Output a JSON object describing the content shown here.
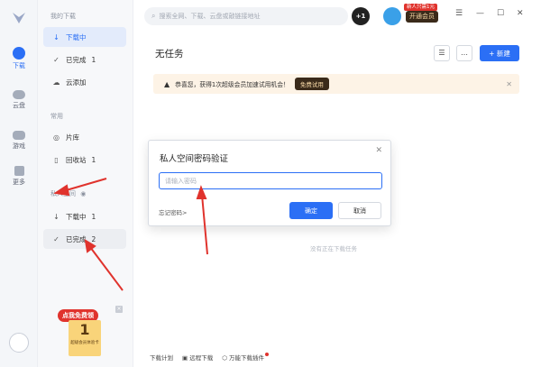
{
  "rail": {
    "items": [
      {
        "label": "下载",
        "icon": "download-icon",
        "active": true
      },
      {
        "label": "云盘",
        "icon": "cloud-icon"
      },
      {
        "label": "游戏",
        "icon": "gamepad-icon"
      },
      {
        "label": "更多",
        "icon": "apps-icon"
      }
    ]
  },
  "sidebar": {
    "section_my_downloads": "我的下载",
    "downloading": {
      "label": "下载中"
    },
    "completed": {
      "label": "已完成",
      "count": "1"
    },
    "cloud_add": {
      "label": "云添加"
    },
    "section_common": "常用",
    "library": {
      "label": "片库"
    },
    "recycle": {
      "label": "回收站",
      "count": "1"
    },
    "section_private": "私人空间",
    "private_downloading": {
      "label": "下载中",
      "count": "1"
    },
    "private_completed": {
      "label": "已完成",
      "count": "2"
    }
  },
  "header": {
    "search_placeholder": "搜索全网、下载、云盘或敲链接地址",
    "plus_badge": "+1",
    "vip_tag": "新人只需1元",
    "vip_button": "开通会员"
  },
  "main": {
    "title": "无任务",
    "new_button": "+ 新建",
    "banner_text": "恭喜您，获得1次超级会员加速试用机会！",
    "banner_button": "免费试用",
    "empty_text": "没有正在下载任务"
  },
  "dialog": {
    "title": "私人空间密码验证",
    "password_placeholder": "请输入密码",
    "forgot": "忘记密码>",
    "confirm": "确定",
    "cancel": "取消"
  },
  "footer": {
    "plan": "下载计划",
    "remote": "远程下载",
    "plugin": "万能下载插件"
  },
  "promo": {
    "tag": "点我免费领",
    "number": "1",
    "unit_text": "超级会员体验卡"
  },
  "colors": {
    "accent": "#2b6ff5",
    "annotation_arrow": "#e0332d"
  }
}
